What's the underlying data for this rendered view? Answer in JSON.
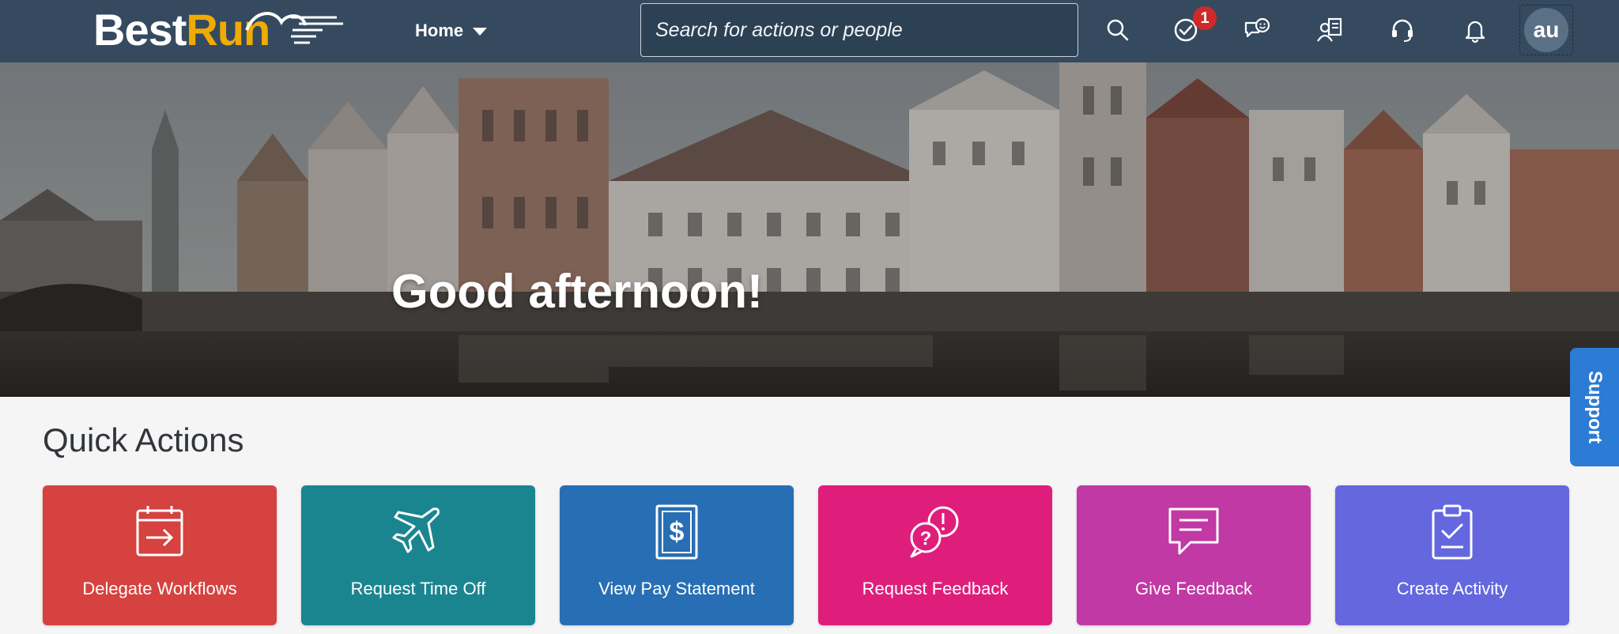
{
  "header": {
    "logo": {
      "part1": "Best",
      "part2": "Run"
    },
    "home_label": "Home",
    "search_placeholder": "Search for actions or people",
    "icons": [
      "search-icon",
      "task-check-icon",
      "chat-smiley-icon",
      "people-directory-icon",
      "headset-icon",
      "bell-icon"
    ],
    "tasks_badge": "1",
    "avatar_initials": "au"
  },
  "hero": {
    "greeting": "Good afternoon!"
  },
  "support_label": "Support",
  "quick_actions": {
    "title": "Quick Actions",
    "tiles": [
      {
        "label": "Delegate Workflows",
        "icon": "calendar-arrow-icon",
        "color": "#d5423f"
      },
      {
        "label": "Request Time Off",
        "icon": "airplane-icon",
        "color": "#1b858f"
      },
      {
        "label": "View Pay Statement",
        "icon": "pay-statement-icon",
        "color": "#286eb4"
      },
      {
        "label": "Request Feedback",
        "icon": "feedback-bubbles-icon",
        "color": "#df1e7c"
      },
      {
        "label": "Give Feedback",
        "icon": "comment-icon",
        "color": "#c139a4"
      },
      {
        "label": "Create Activity",
        "icon": "clipboard-check-icon",
        "color": "#6467de"
      }
    ]
  },
  "colors": {
    "shellbar": "#354a5f",
    "accent": "#f0ab00",
    "badge": "#d0292a",
    "support": "#2c7bd4"
  }
}
